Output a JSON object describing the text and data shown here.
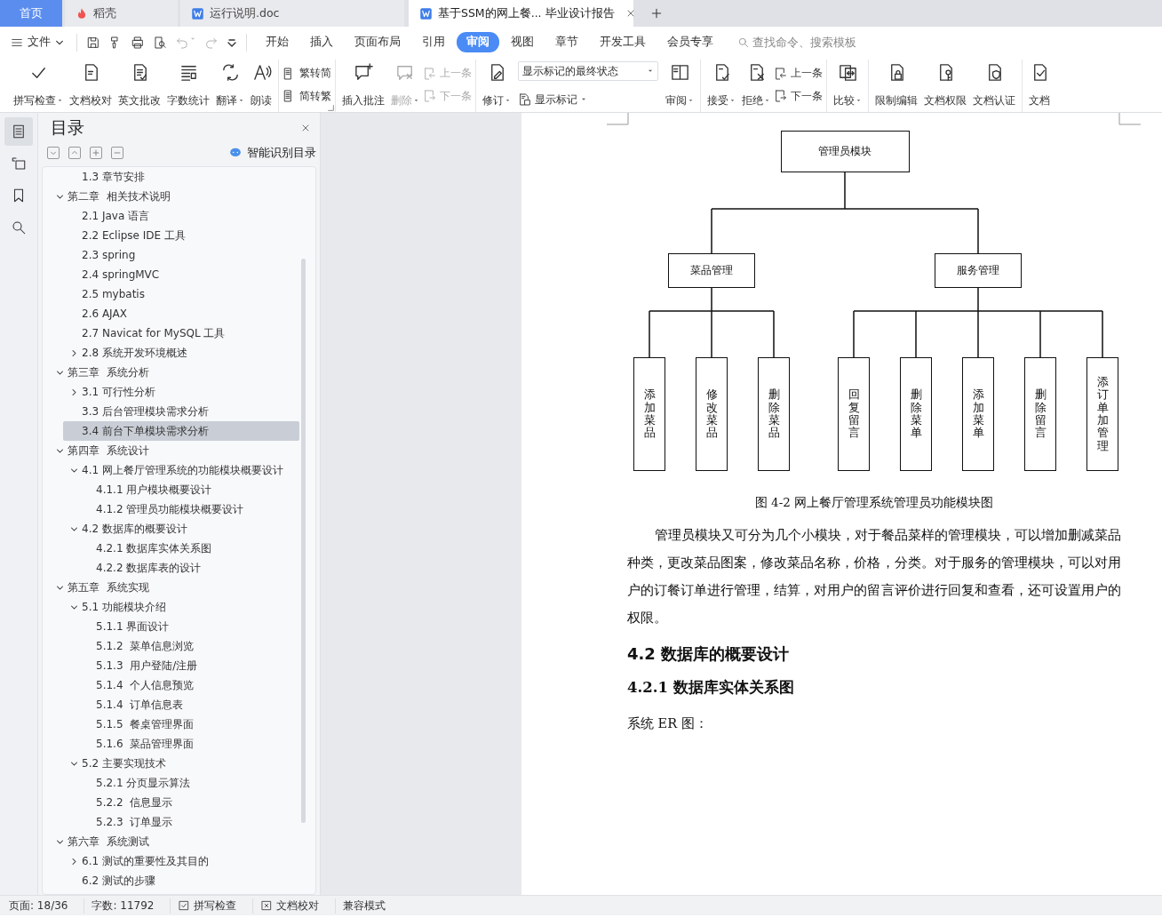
{
  "tabs": [
    {
      "label": "首页",
      "kind": "home",
      "selected": false
    },
    {
      "label": "稻壳",
      "kind": "docer",
      "selected": false
    },
    {
      "label": "运行说明.doc",
      "kind": "doc",
      "selected": false
    },
    {
      "label": "基于SSM的网上餐...  毕业设计报告",
      "kind": "doc",
      "selected": true
    }
  ],
  "menu": {
    "file_label": "文件",
    "tabs": [
      {
        "label": "开始",
        "selected": false
      },
      {
        "label": "插入",
        "selected": false
      },
      {
        "label": "页面布局",
        "selected": false
      },
      {
        "label": "引用",
        "selected": false
      },
      {
        "label": "审阅",
        "selected": true
      },
      {
        "label": "视图",
        "selected": false
      },
      {
        "label": "章节",
        "selected": false
      },
      {
        "label": "开发工具",
        "selected": false
      },
      {
        "label": "会员专享",
        "selected": false
      }
    ],
    "search": {
      "placeholder": "查找命令、搜索模板"
    }
  },
  "ribbon": {
    "groups": [
      {
        "items": [
          {
            "kind": "big",
            "label": "拼写检查",
            "dropdown": true,
            "disabled": false
          },
          {
            "kind": "big",
            "label": "文档校对",
            "dropdown": false,
            "disabled": false
          },
          {
            "kind": "big",
            "label": "英文批改",
            "dropdown": false,
            "disabled": false
          },
          {
            "kind": "big",
            "label": "字数统计",
            "dropdown": false,
            "disabled": false
          },
          {
            "kind": "big",
            "label": "翻译",
            "dropdown": true,
            "disabled": false
          },
          {
            "kind": "big",
            "label": "朗读",
            "dropdown": false,
            "disabled": false
          }
        ]
      },
      {
        "launcher": true,
        "items": [
          {
            "kind": "pair",
            "buttons": [
              {
                "label": "繁转简",
                "disabled": false
              },
              {
                "label": "简转繁",
                "disabled": false
              }
            ]
          }
        ]
      },
      {
        "items": [
          {
            "kind": "big",
            "label": "插入批注",
            "dropdown": false,
            "disabled": false
          },
          {
            "kind": "big",
            "label": "删除",
            "dropdown": true,
            "disabled": true
          },
          {
            "kind": "pair",
            "buttons": [
              {
                "label": "上一条",
                "disabled": true
              },
              {
                "label": "下一条",
                "disabled": true
              }
            ]
          }
        ]
      },
      {
        "items": [
          {
            "kind": "big",
            "label": "修订",
            "dropdown": true,
            "disabled": false
          },
          {
            "kind": "display",
            "value": "显示标记的最终状态",
            "button": "显示标记"
          },
          {
            "kind": "big",
            "label": "审阅",
            "dropdown": true,
            "disabled": false
          }
        ]
      },
      {
        "items": [
          {
            "kind": "big",
            "label": "接受",
            "dropdown": true,
            "disabled": false
          },
          {
            "kind": "big",
            "label": "拒绝",
            "dropdown": true,
            "disabled": false
          },
          {
            "kind": "pair",
            "buttons": [
              {
                "label": "上一条",
                "disabled": false
              },
              {
                "label": "下一条",
                "disabled": false
              }
            ]
          }
        ]
      },
      {
        "items": [
          {
            "kind": "big",
            "label": "比较",
            "dropdown": true,
            "disabled": false
          }
        ]
      },
      {
        "items": [
          {
            "kind": "big",
            "label": "限制编辑",
            "dropdown": false,
            "disabled": false
          },
          {
            "kind": "big",
            "label": "文档权限",
            "dropdown": false,
            "disabled": false
          },
          {
            "kind": "big",
            "label": "文档认证",
            "dropdown": false,
            "disabled": false
          }
        ]
      },
      {
        "items": [
          {
            "kind": "big",
            "label": "文档",
            "dropdown": false,
            "disabled": false
          }
        ]
      }
    ]
  },
  "sidebar": {
    "rail": [
      {
        "selected": true
      },
      {
        "selected": false
      },
      {
        "selected": false
      },
      {
        "selected": false
      }
    ],
    "title": "目录",
    "smart_button": "智能识别目录",
    "toc": [
      {
        "children": [
          {
            "label": "1.3 章节安排",
            "selected": false
          }
        ]
      },
      {
        "label": "第二章  相关技术说明",
        "expanded": true,
        "selected": false,
        "children": [
          {
            "label": "2.1 Java 语言",
            "selected": false
          },
          {
            "label": "2.2 Eclipse IDE 工具",
            "selected": false
          },
          {
            "label": "2.3 spring",
            "selected": false
          },
          {
            "label": "2.4 springMVC",
            "selected": false
          },
          {
            "label": "2.5 mybatis",
            "selected": false
          },
          {
            "label": "2.6 AJAX",
            "selected": false
          },
          {
            "label": "2.7 Navicat for MySQL 工具",
            "selected": false
          },
          {
            "label": "2.8 系统开发环境概述",
            "expanded": false,
            "selected": false
          }
        ]
      },
      {
        "label": "第三章  系统分析",
        "expanded": true,
        "selected": false,
        "children": [
          {
            "label": "3.1 可行性分析",
            "expanded": false,
            "selected": false
          },
          {
            "label": "3.3 后台管理模块需求分析",
            "selected": false
          },
          {
            "label": "3.4 前台下单模块需求分析",
            "selected": true
          }
        ]
      },
      {
        "label": "第四章  系统设计",
        "expanded": true,
        "selected": false,
        "children": [
          {
            "label": "4.1 网上餐厅管理系统的功能模块概要设计",
            "expanded": true,
            "selected": false,
            "children": [
              {
                "label": "4.1.1 用户模块概要设计",
                "selected": false
              },
              {
                "label": "4.1.2 管理员功能模块概要设计",
                "selected": false
              }
            ]
          },
          {
            "label": "4.2 数据库的概要设计",
            "expanded": true,
            "selected": false,
            "children": [
              {
                "label": "4.2.1 数据库实体关系图",
                "selected": false
              },
              {
                "label": "4.2.2 数据库表的设计",
                "selected": false
              }
            ]
          }
        ]
      },
      {
        "label": "第五章  系统实现",
        "expanded": true,
        "selected": false,
        "children": [
          {
            "label": "5.1 功能模块介绍",
            "expanded": true,
            "selected": false,
            "children": [
              {
                "label": "5.1.1 界面设计",
                "selected": false
              },
              {
                "label": "5.1.2  菜单信息浏览",
                "selected": false
              },
              {
                "label": "5.1.3  用户登陆/注册",
                "selected": false
              },
              {
                "label": "5.1.4  个人信息预览",
                "selected": false
              },
              {
                "label": "5.1.4  订单信息表",
                "selected": false
              },
              {
                "label": "5.1.5  餐桌管理界面",
                "selected": false
              },
              {
                "label": "5.1.6  菜品管理界面",
                "selected": false
              }
            ]
          },
          {
            "label": "5.2 主要实现技术",
            "expanded": true,
            "selected": false,
            "children": [
              {
                "label": "5.2.1 分页显示算法",
                "selected": false
              },
              {
                "label": "5.2.2  信息显示",
                "selected": false
              },
              {
                "label": "5.2.3  订单显示",
                "selected": false
              }
            ]
          }
        ]
      },
      {
        "label": "第六章  系统测试",
        "expanded": true,
        "selected": false,
        "children": [
          {
            "label": "6.1 测试的重要性及其目的",
            "expanded": false,
            "selected": false
          },
          {
            "label": "6.2 测试的步骤",
            "selected": false
          }
        ]
      }
    ]
  },
  "document": {
    "diagram": {
      "label": "管理员模块",
      "children": [
        {
          "label": "菜品管理",
          "children": [
            {
              "label": "添加菜品"
            },
            {
              "label": "修改菜品"
            },
            {
              "label": "删除菜品"
            }
          ]
        },
        {
          "label": "服务管理",
          "children": [
            {
              "label": "回复留言"
            },
            {
              "label": "删除菜单"
            },
            {
              "label": "添加菜单"
            },
            {
              "label": "删除留言"
            },
            {
              "label": "添订单加管理"
            }
          ]
        }
      ]
    },
    "blocks": [
      {
        "kind": "caption",
        "text": "图 4-2 网上餐厅管理系统管理员功能模块图"
      },
      {
        "kind": "body",
        "text": "管理员模块又可分为几个小模块，对于餐品菜样的管理模块，可以增加删减菜品种类，更改菜品图案，修改菜品名称，价格，分类。对于服务的管理模块，可以对用户的订餐订单进行管理，结算，对用户的留言评价进行回复和查看，还可设置用户的权限。"
      },
      {
        "kind": "h2",
        "text": "4.2 数据库的概要设计"
      },
      {
        "kind": "h3",
        "text": "4.2.1 数据库实体关系图"
      },
      {
        "kind": "plain",
        "text": "系统 ER 图："
      }
    ]
  },
  "status_bar": [
    {
      "kind": "text",
      "label": "页面: 18/36"
    },
    {
      "kind": "text",
      "label": "字数: 11792"
    },
    {
      "kind": "check",
      "label": "拼写检查"
    },
    {
      "kind": "proof",
      "label": "文档校对"
    },
    {
      "kind": "text",
      "label": "兼容模式"
    }
  ]
}
